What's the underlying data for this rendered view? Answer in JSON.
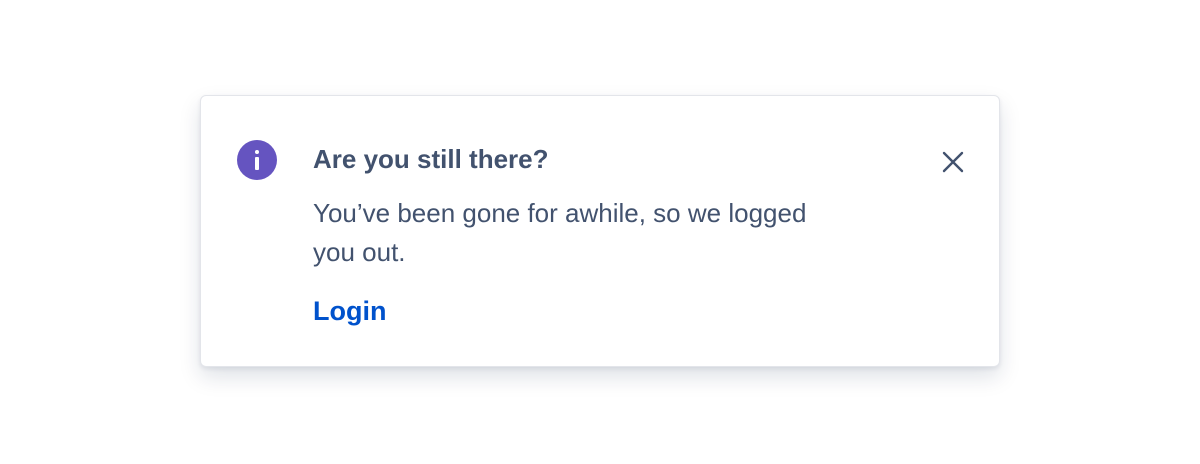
{
  "flag": {
    "icon": "info-icon",
    "title": "Are you still there?",
    "message": "You’ve been gone for awhile, so we logged you out.",
    "action_label": "Login",
    "close_icon": "close-icon"
  },
  "colors": {
    "icon_background": "#6554c0",
    "text": "#42526e",
    "link": "#0052cc"
  }
}
